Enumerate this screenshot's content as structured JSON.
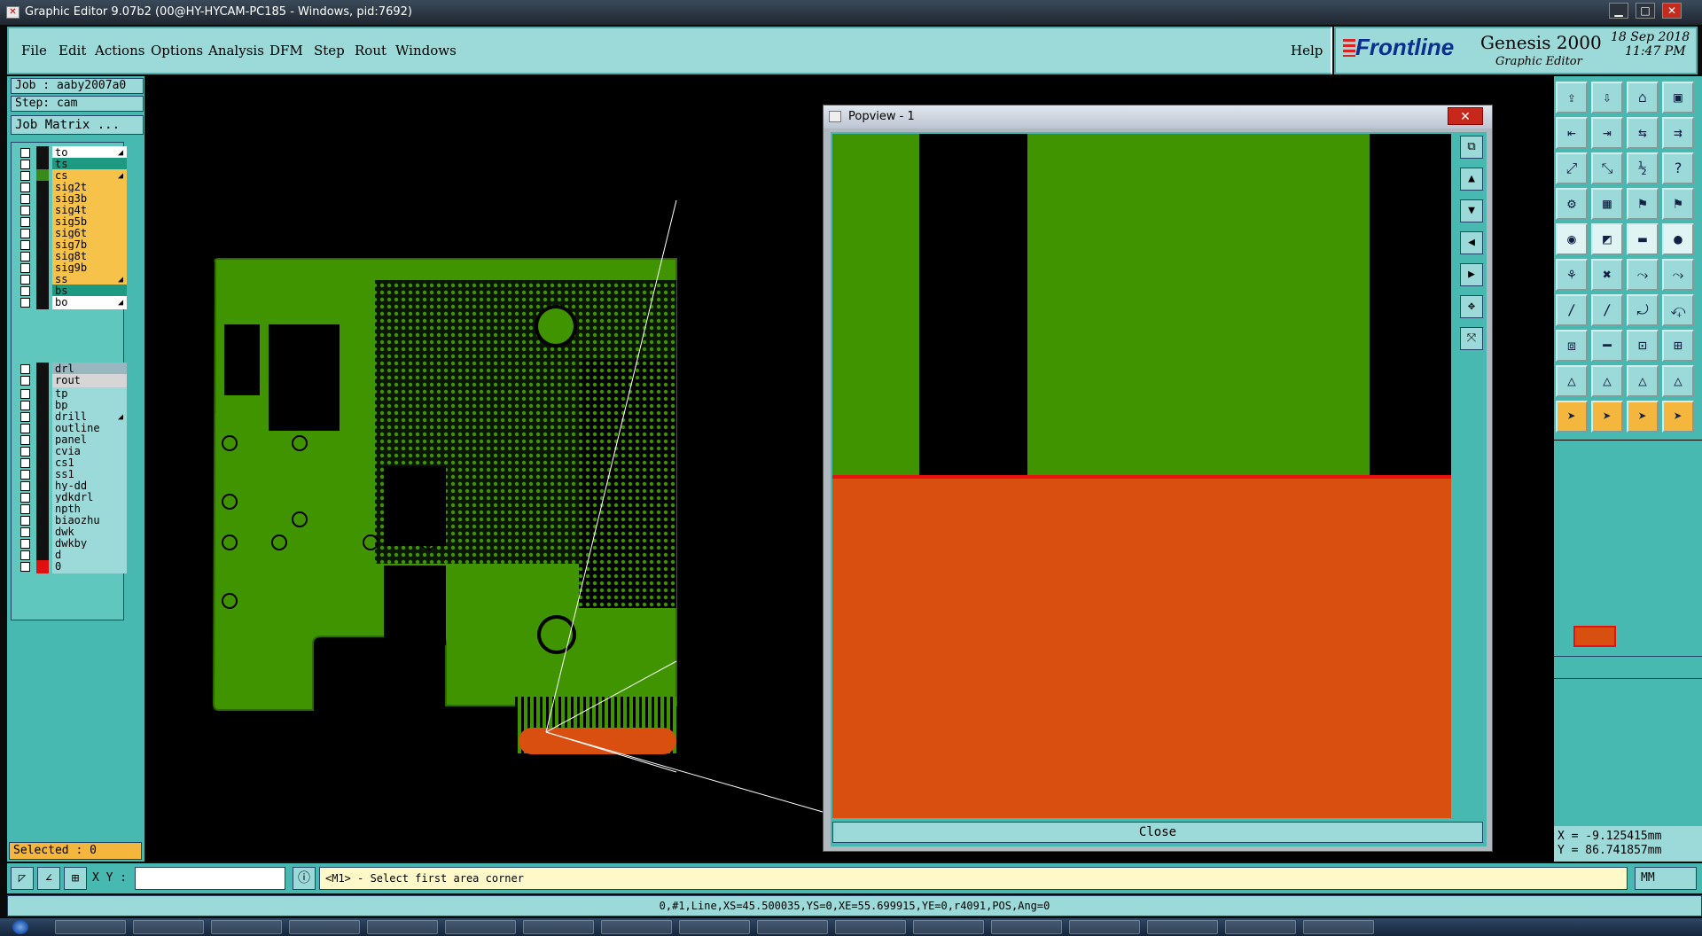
{
  "window": {
    "title": "Graphic Editor 9.07b2 (00@HY-HYCAM-PC185 - Windows, pid:7692)",
    "minimize": "▁",
    "maximize": "□",
    "close": "✕"
  },
  "menu": {
    "items": [
      "File",
      "Edit",
      "Actions",
      "Options",
      "Analysis",
      "DFM",
      "Step",
      "Rout",
      "Windows"
    ],
    "help": "Help"
  },
  "brand": {
    "logo": "Frontline",
    "product": "Genesis 2000",
    "subtitle": "Graphic Editor",
    "date": "18 Sep 2018",
    "time": "11:47 PM"
  },
  "job": {
    "job": "Job : aaby2007a0",
    "step": "Step: cam",
    "matrix_button": "Job Matrix ..."
  },
  "layers": {
    "group1": [
      {
        "name": "to",
        "color": "#ffffff",
        "swatch": "#111111",
        "arrow": true
      },
      {
        "name": "ts",
        "color": "#1f9a82",
        "swatch": "#111111",
        "arrow": false
      },
      {
        "name": "cs",
        "color": "#f7c24a",
        "swatch": "#3a8a1a",
        "arrow": true
      },
      {
        "name": "sig2t",
        "color": "#f7c24a",
        "swatch": "#111111",
        "arrow": false
      },
      {
        "name": "sig3b",
        "color": "#f7c24a",
        "swatch": "#111111",
        "arrow": false
      },
      {
        "name": "sig4t",
        "color": "#f7c24a",
        "swatch": "#111111",
        "arrow": false
      },
      {
        "name": "sig5b",
        "color": "#f7c24a",
        "swatch": "#111111",
        "arrow": false
      },
      {
        "name": "sig6t",
        "color": "#f7c24a",
        "swatch": "#111111",
        "arrow": false
      },
      {
        "name": "sig7b",
        "color": "#f7c24a",
        "swatch": "#111111",
        "arrow": false
      },
      {
        "name": "sig8t",
        "color": "#f7c24a",
        "swatch": "#111111",
        "arrow": false
      },
      {
        "name": "sig9b",
        "color": "#f7c24a",
        "swatch": "#111111",
        "arrow": false
      },
      {
        "name": "ss",
        "color": "#f7c24a",
        "swatch": "#111111",
        "arrow": true
      },
      {
        "name": "bs",
        "color": "#1f9a82",
        "swatch": "#111111",
        "arrow": false
      },
      {
        "name": "bo",
        "color": "#ffffff",
        "swatch": "#111111",
        "arrow": true
      }
    ],
    "group2": [
      {
        "name": "drl",
        "color": "#9ab6be",
        "swatch": "#111111",
        "arrow": false
      },
      {
        "name": "rout",
        "color": "#d6d6d6",
        "swatch": "#111111",
        "arrow": false
      }
    ],
    "group3": [
      {
        "name": "tp",
        "color": "#9cd9d9",
        "swatch": "#111111",
        "arrow": false
      },
      {
        "name": "bp",
        "color": "#9cd9d9",
        "swatch": "#111111",
        "arrow": false
      },
      {
        "name": "drill",
        "color": "#9cd9d9",
        "swatch": "#111111",
        "arrow": true
      },
      {
        "name": "outline",
        "color": "#9cd9d9",
        "swatch": "#111111",
        "arrow": false
      },
      {
        "name": "panel",
        "color": "#9cd9d9",
        "swatch": "#111111",
        "arrow": false
      },
      {
        "name": "cvia",
        "color": "#9cd9d9",
        "swatch": "#111111",
        "arrow": false
      },
      {
        "name": "cs1",
        "color": "#9cd9d9",
        "swatch": "#111111",
        "arrow": false
      },
      {
        "name": "ss1",
        "color": "#9cd9d9",
        "swatch": "#111111",
        "arrow": false
      },
      {
        "name": "hy-dd",
        "color": "#9cd9d9",
        "swatch": "#111111",
        "arrow": false
      },
      {
        "name": "ydkdrl",
        "color": "#9cd9d9",
        "swatch": "#111111",
        "arrow": false
      },
      {
        "name": "npth",
        "color": "#9cd9d9",
        "swatch": "#111111",
        "arrow": false
      },
      {
        "name": "biaozhu",
        "color": "#9cd9d9",
        "swatch": "#111111",
        "arrow": false
      },
      {
        "name": "dwk",
        "color": "#9cd9d9",
        "swatch": "#111111",
        "arrow": false
      },
      {
        "name": "dwkby",
        "color": "#9cd9d9",
        "swatch": "#111111",
        "arrow": false
      },
      {
        "name": "d",
        "color": "#9cd9d9",
        "swatch": "#111111",
        "arrow": false
      },
      {
        "name": "0",
        "color": "#9cd9d9",
        "swatch": "#e01010",
        "arrow": false
      }
    ]
  },
  "selected": "Selected : 0",
  "popview": {
    "title": "Popview - 1",
    "close_label": "Close"
  },
  "coords": {
    "x": "X = -9.125415mm",
    "y": "Y = 86.741857mm"
  },
  "bottom": {
    "xy_label": "X Y :",
    "input_value": "",
    "prompt": "<M1> - Select first area corner",
    "units": "MM"
  },
  "status_line": "0,#1,Line,XS=45.500035,YS=0,XE=55.699915,YE=0,r4091,POS,Ang=0",
  "colors": {
    "board_green": "#3f9400",
    "copper_orange": "#d94f10",
    "panel_teal": "#47b9b0",
    "button_cyan": "#9cd9d9"
  }
}
